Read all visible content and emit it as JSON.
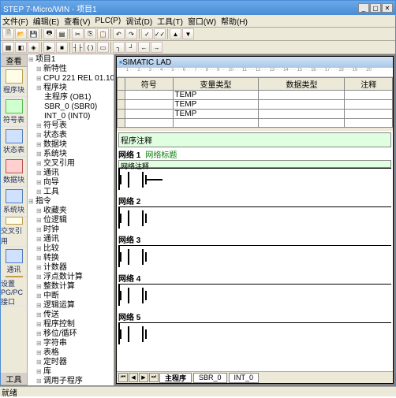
{
  "title": "STEP 7-Micro/WIN - 项目1",
  "menu": [
    "文件(F)",
    "编辑(E)",
    "查看(V)",
    "PLC(P)",
    "调试(D)",
    "工具(T)",
    "窗口(W)",
    "帮助(H)"
  ],
  "sidebar_title": "查看",
  "sidebar": [
    {
      "label": "程序块",
      "cls": ""
    },
    {
      "label": "符号表",
      "cls": "gr"
    },
    {
      "label": "状态表",
      "cls": "blue"
    },
    {
      "label": "数据块",
      "cls": "red"
    },
    {
      "label": "系统块",
      "cls": "blue"
    },
    {
      "label": "交叉引用",
      "cls": ""
    },
    {
      "label": "通讯",
      "cls": "blue"
    },
    {
      "label": "设置 PG/PC 接口",
      "cls": ""
    }
  ],
  "sidebar_footer": "工具",
  "tree": [
    {
      "text": "项目1",
      "ind": ""
    },
    {
      "text": "新特性",
      "ind": "ind1"
    },
    {
      "text": "CPU 221 REL 01.10",
      "ind": "ind1"
    },
    {
      "text": "程序块",
      "ind": "ind1"
    },
    {
      "text": "主程序 (OB1)",
      "ind": "ind2 leaf"
    },
    {
      "text": "SBR_0 (SBR0)",
      "ind": "ind2 leaf"
    },
    {
      "text": "INT_0 (INT0)",
      "ind": "ind2 leaf"
    },
    {
      "text": "符号表",
      "ind": "ind1"
    },
    {
      "text": "状态表",
      "ind": "ind1"
    },
    {
      "text": "数据块",
      "ind": "ind1"
    },
    {
      "text": "系统块",
      "ind": "ind1"
    },
    {
      "text": "交叉引用",
      "ind": "ind1"
    },
    {
      "text": "通讯",
      "ind": "ind1"
    },
    {
      "text": "向导",
      "ind": "ind1"
    },
    {
      "text": "工具",
      "ind": "ind1"
    },
    {
      "text": "指令",
      "ind": ""
    },
    {
      "text": "收藏夹",
      "ind": "ind1"
    },
    {
      "text": "位逻辑",
      "ind": "ind1"
    },
    {
      "text": "时钟",
      "ind": "ind1"
    },
    {
      "text": "通讯",
      "ind": "ind1"
    },
    {
      "text": "比较",
      "ind": "ind1"
    },
    {
      "text": "转换",
      "ind": "ind1"
    },
    {
      "text": "计数器",
      "ind": "ind1"
    },
    {
      "text": "浮点数计算",
      "ind": "ind1"
    },
    {
      "text": "整数计算",
      "ind": "ind1"
    },
    {
      "text": "中断",
      "ind": "ind1"
    },
    {
      "text": "逻辑运算",
      "ind": "ind1"
    },
    {
      "text": "传送",
      "ind": "ind1"
    },
    {
      "text": "程序控制",
      "ind": "ind1"
    },
    {
      "text": "移位/循环",
      "ind": "ind1"
    },
    {
      "text": "字符串",
      "ind": "ind1"
    },
    {
      "text": "表格",
      "ind": "ind1"
    },
    {
      "text": "定时器",
      "ind": "ind1"
    },
    {
      "text": "库",
      "ind": "ind1"
    },
    {
      "text": "调用子程序",
      "ind": "ind1"
    }
  ],
  "editor_title": "SIMATIC LAD",
  "ruler": "· · · 1 · · · 2 · · · 3 · · · 4 · · · 5 · · · 6 · · · 7 · · · 8 · · · 9 · · · 10 · · · 11 · · · 12 · · · 13 · · · 14 · · · 15 · · · 16 · · · 17 · · · 18 · · · 19 · · · 20",
  "var_headers": [
    "",
    "符号",
    "变量类型",
    "数据类型",
    "注释"
  ],
  "var_type": "TEMP",
  "program_comment": "程序注释",
  "network_prefix": "网络",
  "network_subtitle": "网络标题",
  "network_comment": "网络注释",
  "network_count": 5,
  "tabs": [
    "主程序",
    "SBR_0",
    "INT_0"
  ],
  "status": "就绪"
}
